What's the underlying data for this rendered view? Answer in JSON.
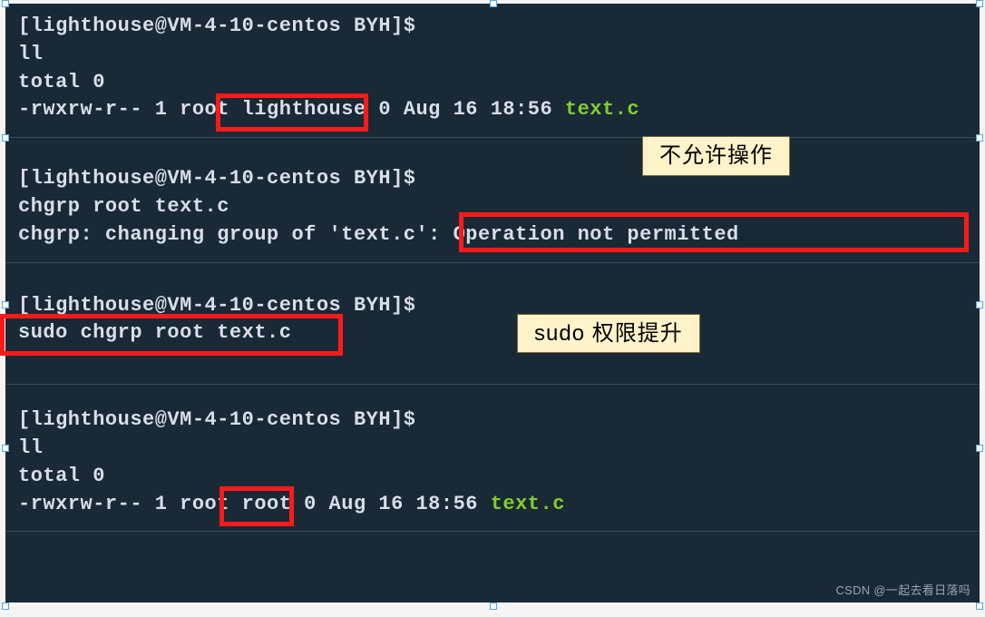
{
  "panel1": {
    "prompt": "[lighthouse@VM-4-10-centos BYH]$",
    "cmd": "ll",
    "total": "total 0",
    "ls_prefix": "-rwxrw-r-- 1 root ",
    "group": "lighthouse",
    "ls_mid": " 0 Aug 16 18:56 ",
    "file": "text.c"
  },
  "panel2": {
    "prompt": "[lighthouse@VM-4-10-centos BYH]$",
    "cmd": "chgrp root text.c",
    "err_pre": "chgrp: changing group of 'text.c': ",
    "err_msg": "Operation not permitted",
    "annotation": "不允许操作"
  },
  "panel3": {
    "prompt": "[lighthouse@VM-4-10-centos BYH]$",
    "cmd": "sudo chgrp root text.c",
    "annotation": "sudo 权限提升"
  },
  "panel4": {
    "prompt": "[lighthouse@VM-4-10-centos BYH]$",
    "cmd": "ll",
    "total": "total 0",
    "ls_prefix": "-rwxrw-r-- 1 root ",
    "group": "root",
    "ls_mid": " 0 Aug 16 18:56 ",
    "file": "text.c"
  },
  "watermark": "CSDN @一起去看日落吗"
}
